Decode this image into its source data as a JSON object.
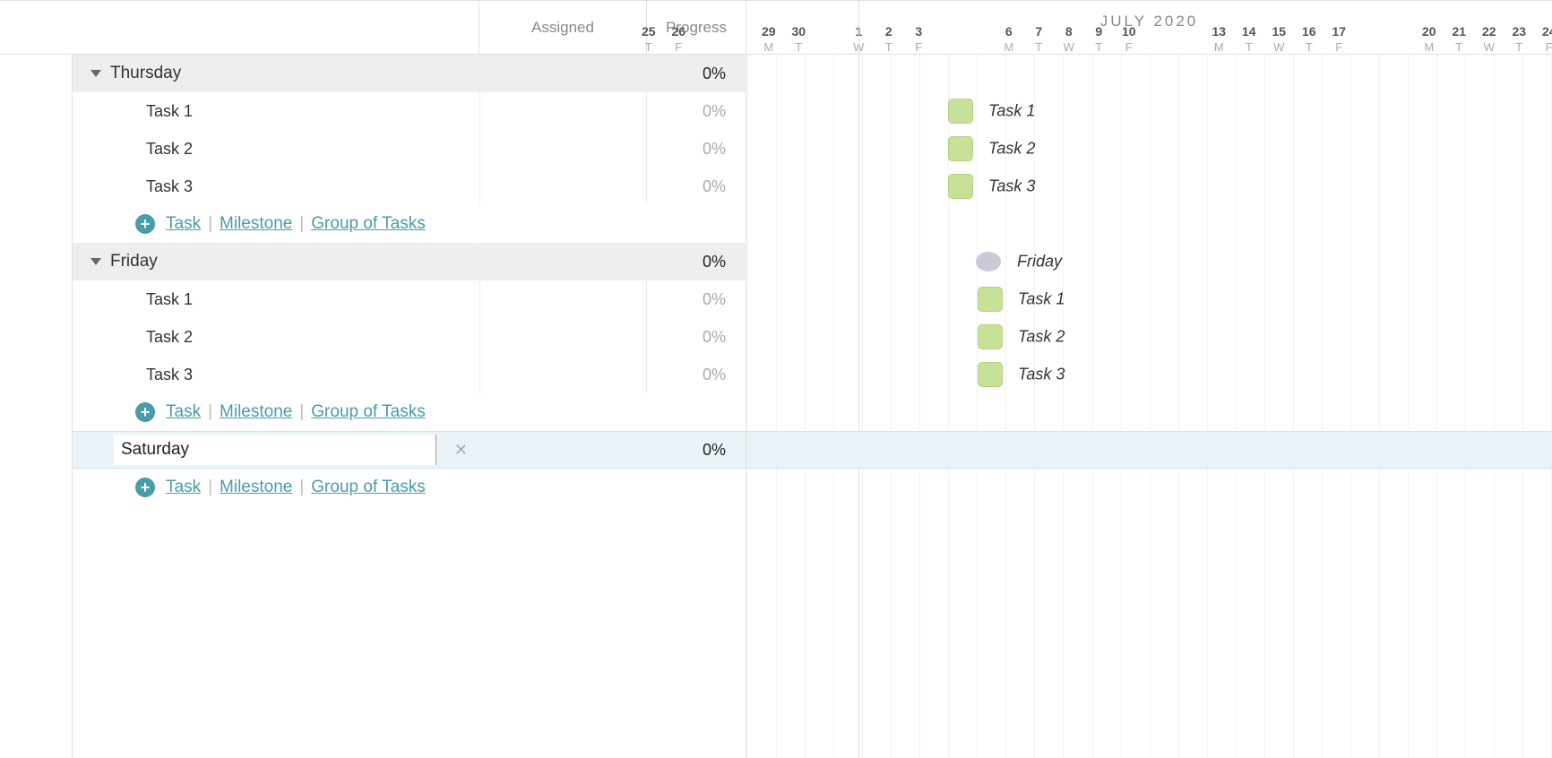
{
  "columns": {
    "assigned": "Assigned",
    "progress": "Progress"
  },
  "timeline": {
    "month_label": "JULY 2020",
    "days": [
      {
        "num": "25",
        "letter": "T"
      },
      {
        "num": "26",
        "letter": "F"
      },
      {
        "num": "",
        "letter": ""
      },
      {
        "num": "",
        "letter": ""
      },
      {
        "num": "29",
        "letter": "M"
      },
      {
        "num": "30",
        "letter": "T"
      },
      {
        "num": "",
        "letter": ""
      },
      {
        "num": "1",
        "letter": "W"
      },
      {
        "num": "2",
        "letter": "T"
      },
      {
        "num": "3",
        "letter": "F"
      },
      {
        "num": "",
        "letter": ""
      },
      {
        "num": "",
        "letter": ""
      },
      {
        "num": "6",
        "letter": "M"
      },
      {
        "num": "7",
        "letter": "T"
      },
      {
        "num": "8",
        "letter": "W"
      },
      {
        "num": "9",
        "letter": "T"
      },
      {
        "num": "10",
        "letter": "F"
      },
      {
        "num": "",
        "letter": ""
      },
      {
        "num": "",
        "letter": ""
      },
      {
        "num": "13",
        "letter": "M"
      },
      {
        "num": "14",
        "letter": "T"
      },
      {
        "num": "15",
        "letter": "W"
      },
      {
        "num": "16",
        "letter": "T"
      },
      {
        "num": "17",
        "letter": "F"
      },
      {
        "num": "",
        "letter": ""
      },
      {
        "num": "",
        "letter": ""
      },
      {
        "num": "20",
        "letter": "M"
      },
      {
        "num": "21",
        "letter": "T"
      },
      {
        "num": "22",
        "letter": "W"
      },
      {
        "num": "23",
        "letter": "T"
      },
      {
        "num": "24",
        "letter": "F"
      },
      {
        "num": "",
        "letter": ""
      }
    ]
  },
  "groups": {
    "thursday": {
      "label": "Thursday",
      "progress": "0%",
      "tasks": [
        {
          "name": "Task 1",
          "progress": "0%"
        },
        {
          "name": "Task 2",
          "progress": "0%"
        },
        {
          "name": "Task 3",
          "progress": "0%"
        }
      ]
    },
    "friday": {
      "label": "Friday",
      "progress": "0%",
      "tasks": [
        {
          "name": "Task 1",
          "progress": "0%"
        },
        {
          "name": "Task 2",
          "progress": "0%"
        },
        {
          "name": "Task 3",
          "progress": "0%"
        }
      ]
    },
    "saturday": {
      "input_value": "Saturday",
      "progress": "0%"
    }
  },
  "add_actions": {
    "task": "Task",
    "milestone": "Milestone",
    "group": "Group of Tasks"
  },
  "gantt": {
    "thursday_tasks": [
      {
        "label": "Task 1"
      },
      {
        "label": "Task 2"
      },
      {
        "label": "Task 3"
      }
    ],
    "friday_milestone_label": "Friday",
    "friday_tasks": [
      {
        "label": "Task 1"
      },
      {
        "label": "Task 2"
      },
      {
        "label": "Task 3"
      }
    ]
  }
}
